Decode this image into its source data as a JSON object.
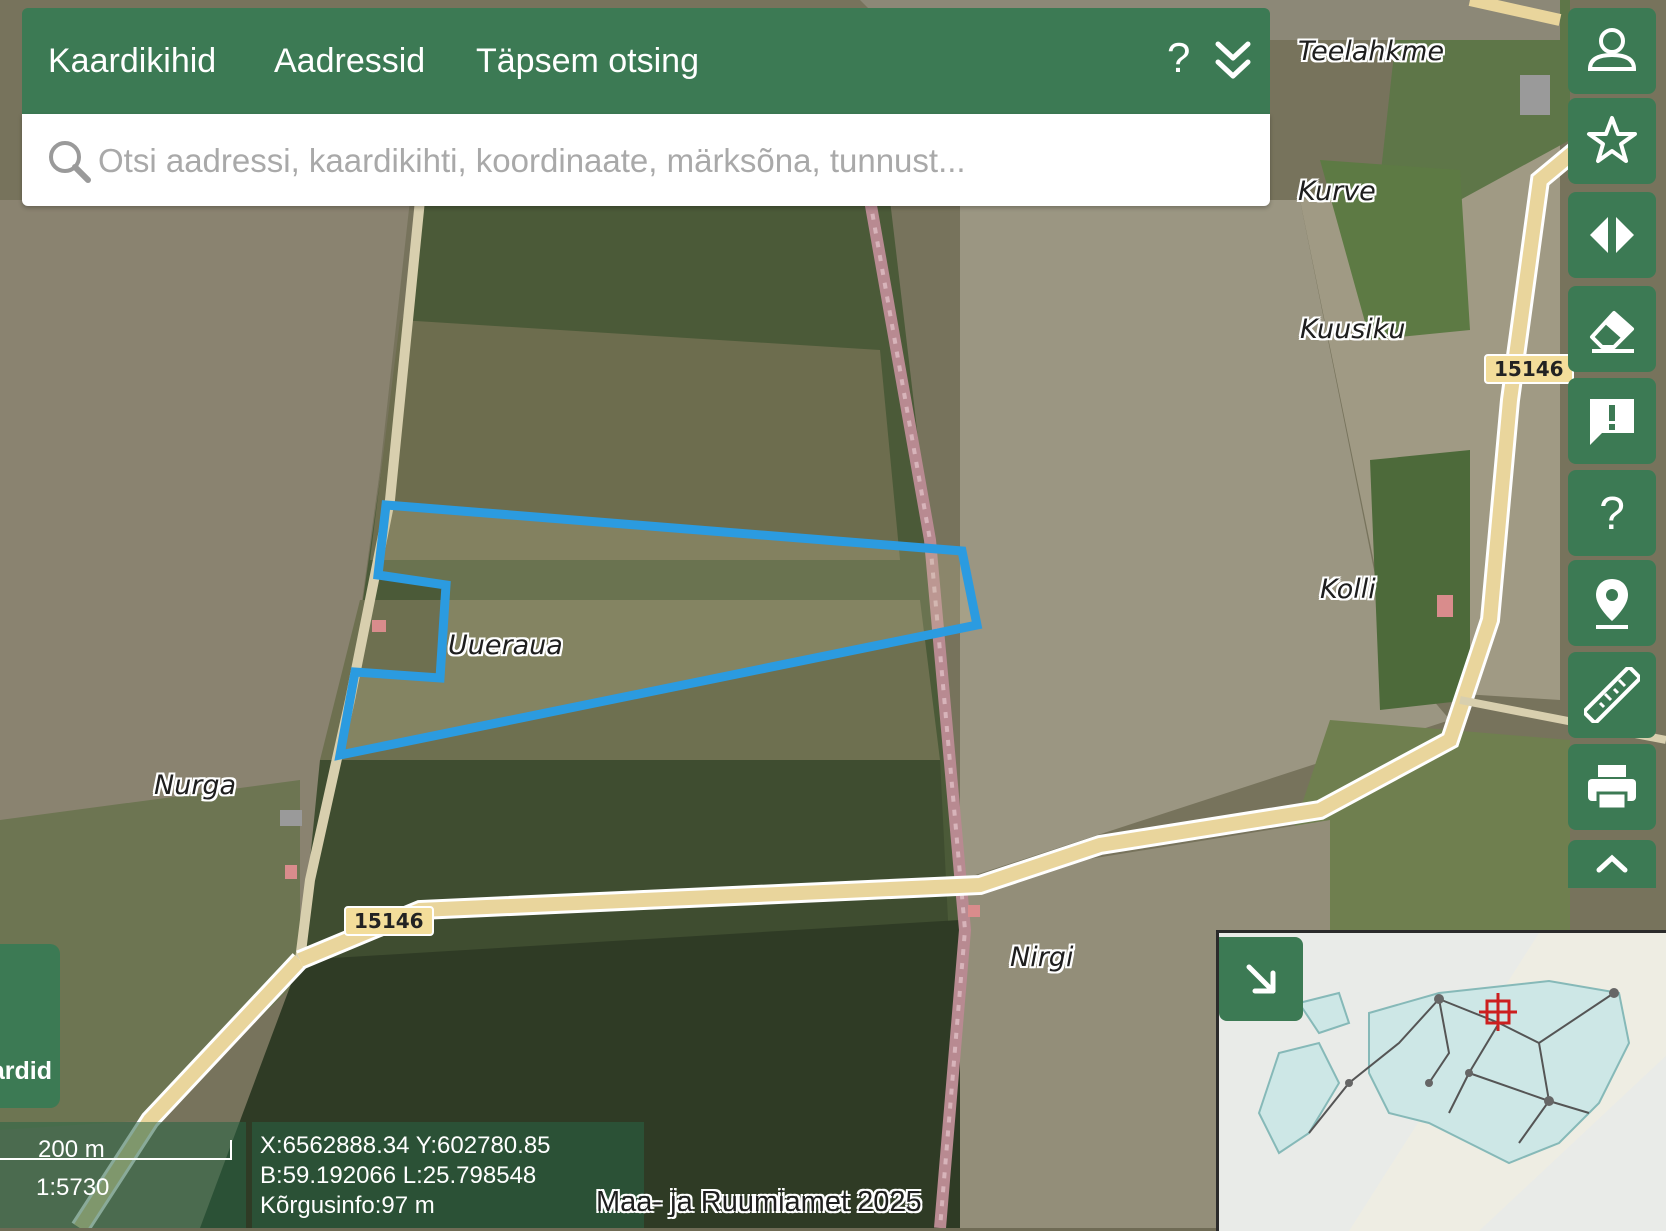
{
  "header": {
    "tabs": [
      {
        "label": "Kaardikihid"
      },
      {
        "label": "Aadressid"
      },
      {
        "label": "Täpsem otsing"
      }
    ],
    "help_label": "?"
  },
  "search": {
    "placeholder": "Otsi aadressi, kaardikihti, koordinaate, märksõna, tunnust...",
    "value": ""
  },
  "toolbar": {
    "items": [
      {
        "icon": "user-icon"
      },
      {
        "icon": "star-icon"
      },
      {
        "icon": "compare-arrows-icon"
      },
      {
        "icon": "eraser-icon"
      },
      {
        "icon": "feedback-icon"
      },
      {
        "icon": "help-icon",
        "label": "?"
      },
      {
        "icon": "location-pin-icon"
      },
      {
        "icon": "ruler-icon"
      },
      {
        "icon": "print-icon"
      }
    ],
    "collapse_icon": "chevron-up-icon"
  },
  "map": {
    "place_labels": [
      "Teelahkme",
      "Kurve",
      "Kuusiku",
      "Kolli",
      "Uueraua",
      "Nurga",
      "Nirgi"
    ],
    "road_numbers": [
      "15146",
      "15146"
    ],
    "selected_parcel": "Uueraua",
    "selection_color": "#2b9be0"
  },
  "left_panel": {
    "label": "ardid"
  },
  "scale": {
    "distance": "200 m",
    "ratio": "1:5730"
  },
  "coordinates": {
    "xy": "X:6562888.34 Y:602780.85",
    "bl": "B:59.192066 L:25.798548",
    "height": "Kõrgusinfo:97 m"
  },
  "attribution": "Maa- ja Ruumiamet 2025",
  "overview": {
    "toggle_icon": "arrow-down-right-icon"
  },
  "colors": {
    "brand_green": "#3c7a54",
    "road_fill": "#e9d59c"
  }
}
